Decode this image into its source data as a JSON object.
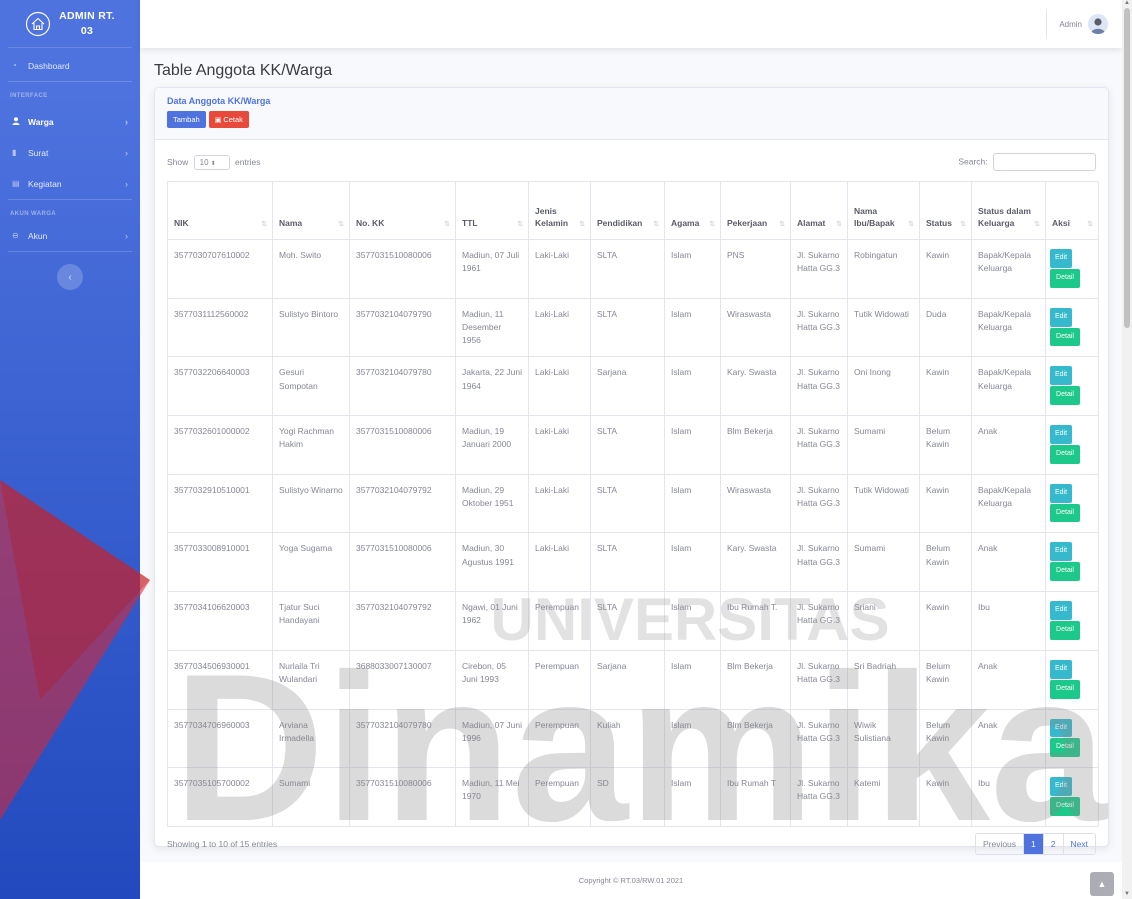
{
  "brand": {
    "title_line1": "ADMIN RT.",
    "title_line2": "03"
  },
  "sidebar": {
    "dashboard": "Dashboard",
    "heading_interface": "INTERFACE",
    "warga": "Warga",
    "surat": "Surat",
    "kegiatan": "Kegiatan",
    "heading_akun": "AKUN WARGA",
    "akun": "Akun"
  },
  "topbar": {
    "user_name": "Admin"
  },
  "page": {
    "title": "Table Anggota KK/Warga"
  },
  "card": {
    "title": "Data Anggota KK/Warga",
    "btn_tambah": "Tambah",
    "btn_cetak": "Cetak"
  },
  "table_controls": {
    "show_label": "Show",
    "entries_value": "10",
    "entries_label": "entries",
    "search_label": "Search:",
    "search_value": ""
  },
  "columns": [
    "NIK",
    "Nama",
    "No. KK",
    "TTL",
    "Jenis Kelamin",
    "Pendidikan",
    "Agama",
    "Pekerjaan",
    "Alamat",
    "Nama Ibu/Bapak",
    "Status",
    "Status dalam Keluarga",
    "Aksi"
  ],
  "rows": [
    [
      "3577030707610002",
      "Moh. Swito",
      "3577031510080006",
      "Madiun, 07 Juli 1961",
      "Laki-Laki",
      "SLTA",
      "Islam",
      "PNS",
      "Jl. Sukarno Hatta GG.3",
      "Robingatun",
      "Kawin",
      "Bapak/Kepala Keluarga"
    ],
    [
      "3577031112560002",
      "Sulistyo Bintoro",
      "3577032104079790",
      "Madiun, 11 Desember 1956",
      "Laki-Laki",
      "SLTA",
      "Islam",
      "Wiraswasta",
      "Jl. Sukarno Hatta GG.3",
      "Tutik Widowati",
      "Duda",
      "Bapak/Kepala Keluarga"
    ],
    [
      "3577032206640003",
      "Gesuri Sompotan",
      "3577032104079780",
      "Jakarta, 22 Juni 1964",
      "Laki-Laki",
      "Sarjana",
      "Islam",
      "Kary. Swasta",
      "Jl. Sukarno Hatta GG.3",
      "Oni Inong",
      "Kawin",
      "Bapak/Kepala Keluarga"
    ],
    [
      "3577032601000002",
      "Yogi Rachman Hakim",
      "3577031510080006",
      "Madiun, 19 Januari 2000",
      "Laki-Laki",
      "SLTA",
      "Islam",
      "Blm Bekerja",
      "Jl. Sukarno Hatta GG.3",
      "Sumami",
      "Belum Kawin",
      "Anak"
    ],
    [
      "3577032910510001",
      "Sulistyo Winarno",
      "3577032104079792",
      "Madiun, 29 Oktober 1951",
      "Laki-Laki",
      "SLTA",
      "Islam",
      "Wiraswasta",
      "Jl. Sukarno Hatta GG.3",
      "Tutik Widowati",
      "Kawin",
      "Bapak/Kepala Keluarga"
    ],
    [
      "3577033008910001",
      "Yoga Sugama",
      "3577031510080006",
      "Madiun, 30 Agustus 1991",
      "Laki-Laki",
      "SLTA",
      "Islam",
      "Kary. Swasta",
      "Jl. Sukarno Hatta GG.3",
      "Sumami",
      "Belum Kawin",
      "Anak"
    ],
    [
      "3577034106620003",
      "Tjatur Suci Handayani",
      "3577032104079792",
      "Ngawi, 01 Juni 1962",
      "Perempuan",
      "SLTA",
      "Islam",
      "Ibu Rumah T.",
      "Jl. Sukarno Hatta GG.3",
      "Sriani",
      "Kawin",
      "Ibu"
    ],
    [
      "3577034506930001",
      "Nurlaila Tri Wulandari",
      "3688033007130007",
      "Cirebon, 05 Juni 1993",
      "Perempuan",
      "Sarjana",
      "Islam",
      "Blm Bekerja",
      "Jl. Sukarno Hatta GG.3",
      "Sri Badriah",
      "Belum Kawin",
      "Anak"
    ],
    [
      "3577034706960003",
      "Arviana Irmadella",
      "3577032104079780",
      "Madiun, 07 Juni 1996",
      "Perempuan",
      "Kuliah",
      "Islam",
      "Blm Bekerja",
      "Jl. Sukarno Hatta GG.3",
      "Wiwik Sulistiana",
      "Belum Kawin",
      "Anak"
    ],
    [
      "3577035105700002",
      "Sumami",
      "3577031510080006",
      "Madiun, 11 Mei 1970",
      "Perempuan",
      "SD",
      "Islam",
      "Ibu Rumah T",
      "Jl. Sukarno Hatta GG.3",
      "Katemi",
      "Kawin",
      "Ibu"
    ]
  ],
  "row_actions": {
    "edit": "Edit",
    "detail": "Detail"
  },
  "table_footer": {
    "info": "Showing 1 to 10 of 15 entries",
    "previous": "Previous",
    "page1": "1",
    "page2": "2",
    "next": "Next"
  },
  "footer": {
    "copyright": "Copyright © RT.03/RW.01 2021"
  },
  "watermark": {
    "line1": "UNIVERSITAS",
    "line2": "Dinamika"
  },
  "colors": {
    "primary": "#4e73df",
    "danger": "#e74a3b",
    "info": "#36b9cc",
    "success": "#1cc88a",
    "watermark_red": "#e0262e"
  },
  "icons": [
    "home-icon",
    "dashboard-icon",
    "user-icon",
    "file-icon",
    "calendar-icon",
    "user-circle-icon",
    "chevron-right-icon",
    "chevron-left-icon",
    "print-icon",
    "sort-icon",
    "chevron-up-icon"
  ]
}
